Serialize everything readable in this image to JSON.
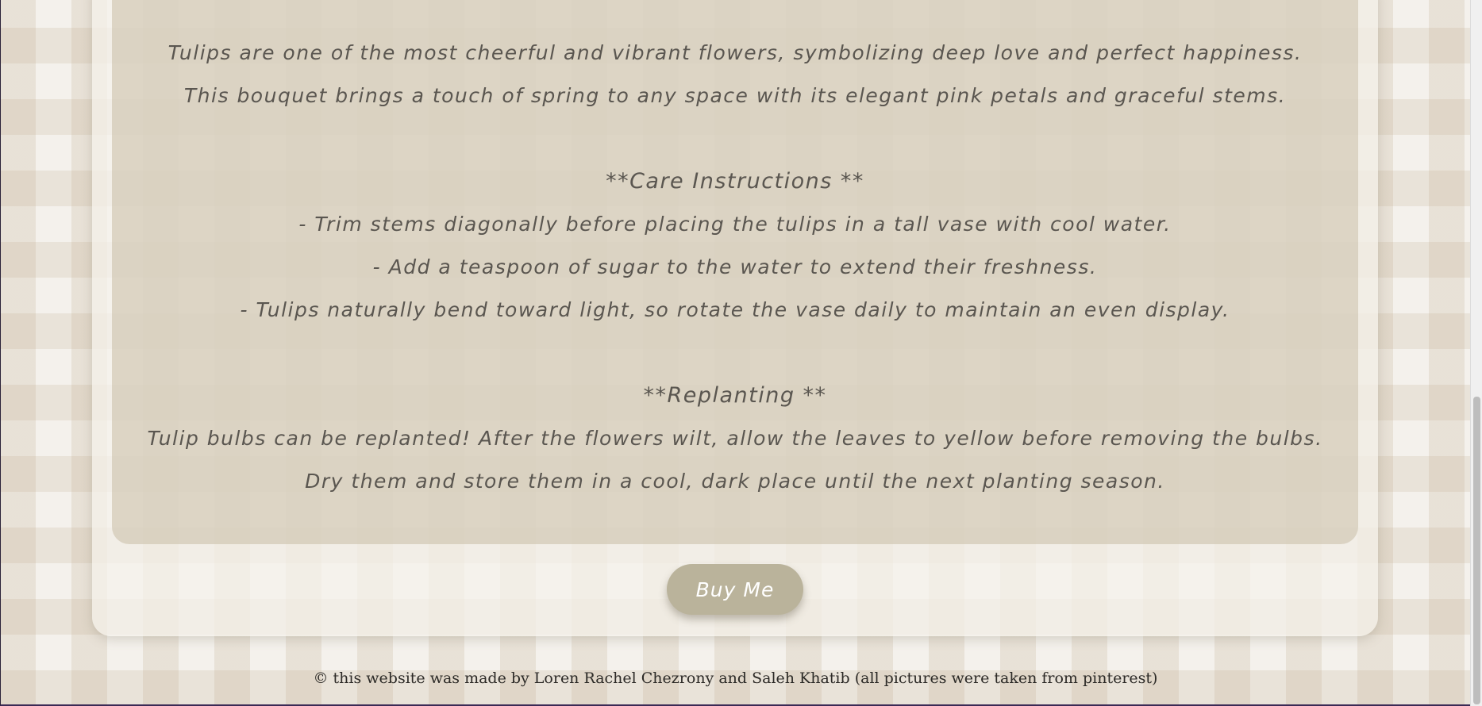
{
  "description": {
    "intro_lines": [
      "Tulips are one of the most cheerful and vibrant flowers, symbolizing deep love and perfect happiness.",
      "This bouquet brings a touch of spring to any space with its elegant pink petals and graceful stems."
    ],
    "care": {
      "heading": "**Care Instructions **",
      "items": [
        "- Trim stems diagonally before placing the tulips in a tall vase with cool water.",
        "- Add a teaspoon of sugar to the water to extend their freshness.",
        "- Tulips naturally bend toward light, so rotate the vase daily to maintain an even display."
      ]
    },
    "replanting": {
      "heading": "**Replanting **",
      "lines": [
        "Tulip bulbs can be replanted! After the flowers wilt, allow the leaves to yellow before removing the bulbs.",
        "Dry them and store them in a cool, dark place until the next planting season."
      ]
    }
  },
  "buy_button": {
    "label": "Buy Me"
  },
  "footer": {
    "text": "© this website was made by Loren Rachel Chezrony and Saleh Khatib (all pictures were taken from pinterest)"
  },
  "colors": {
    "button": "#bab39b",
    "text": "#5a5650",
    "panel": "#d6cfbd"
  }
}
